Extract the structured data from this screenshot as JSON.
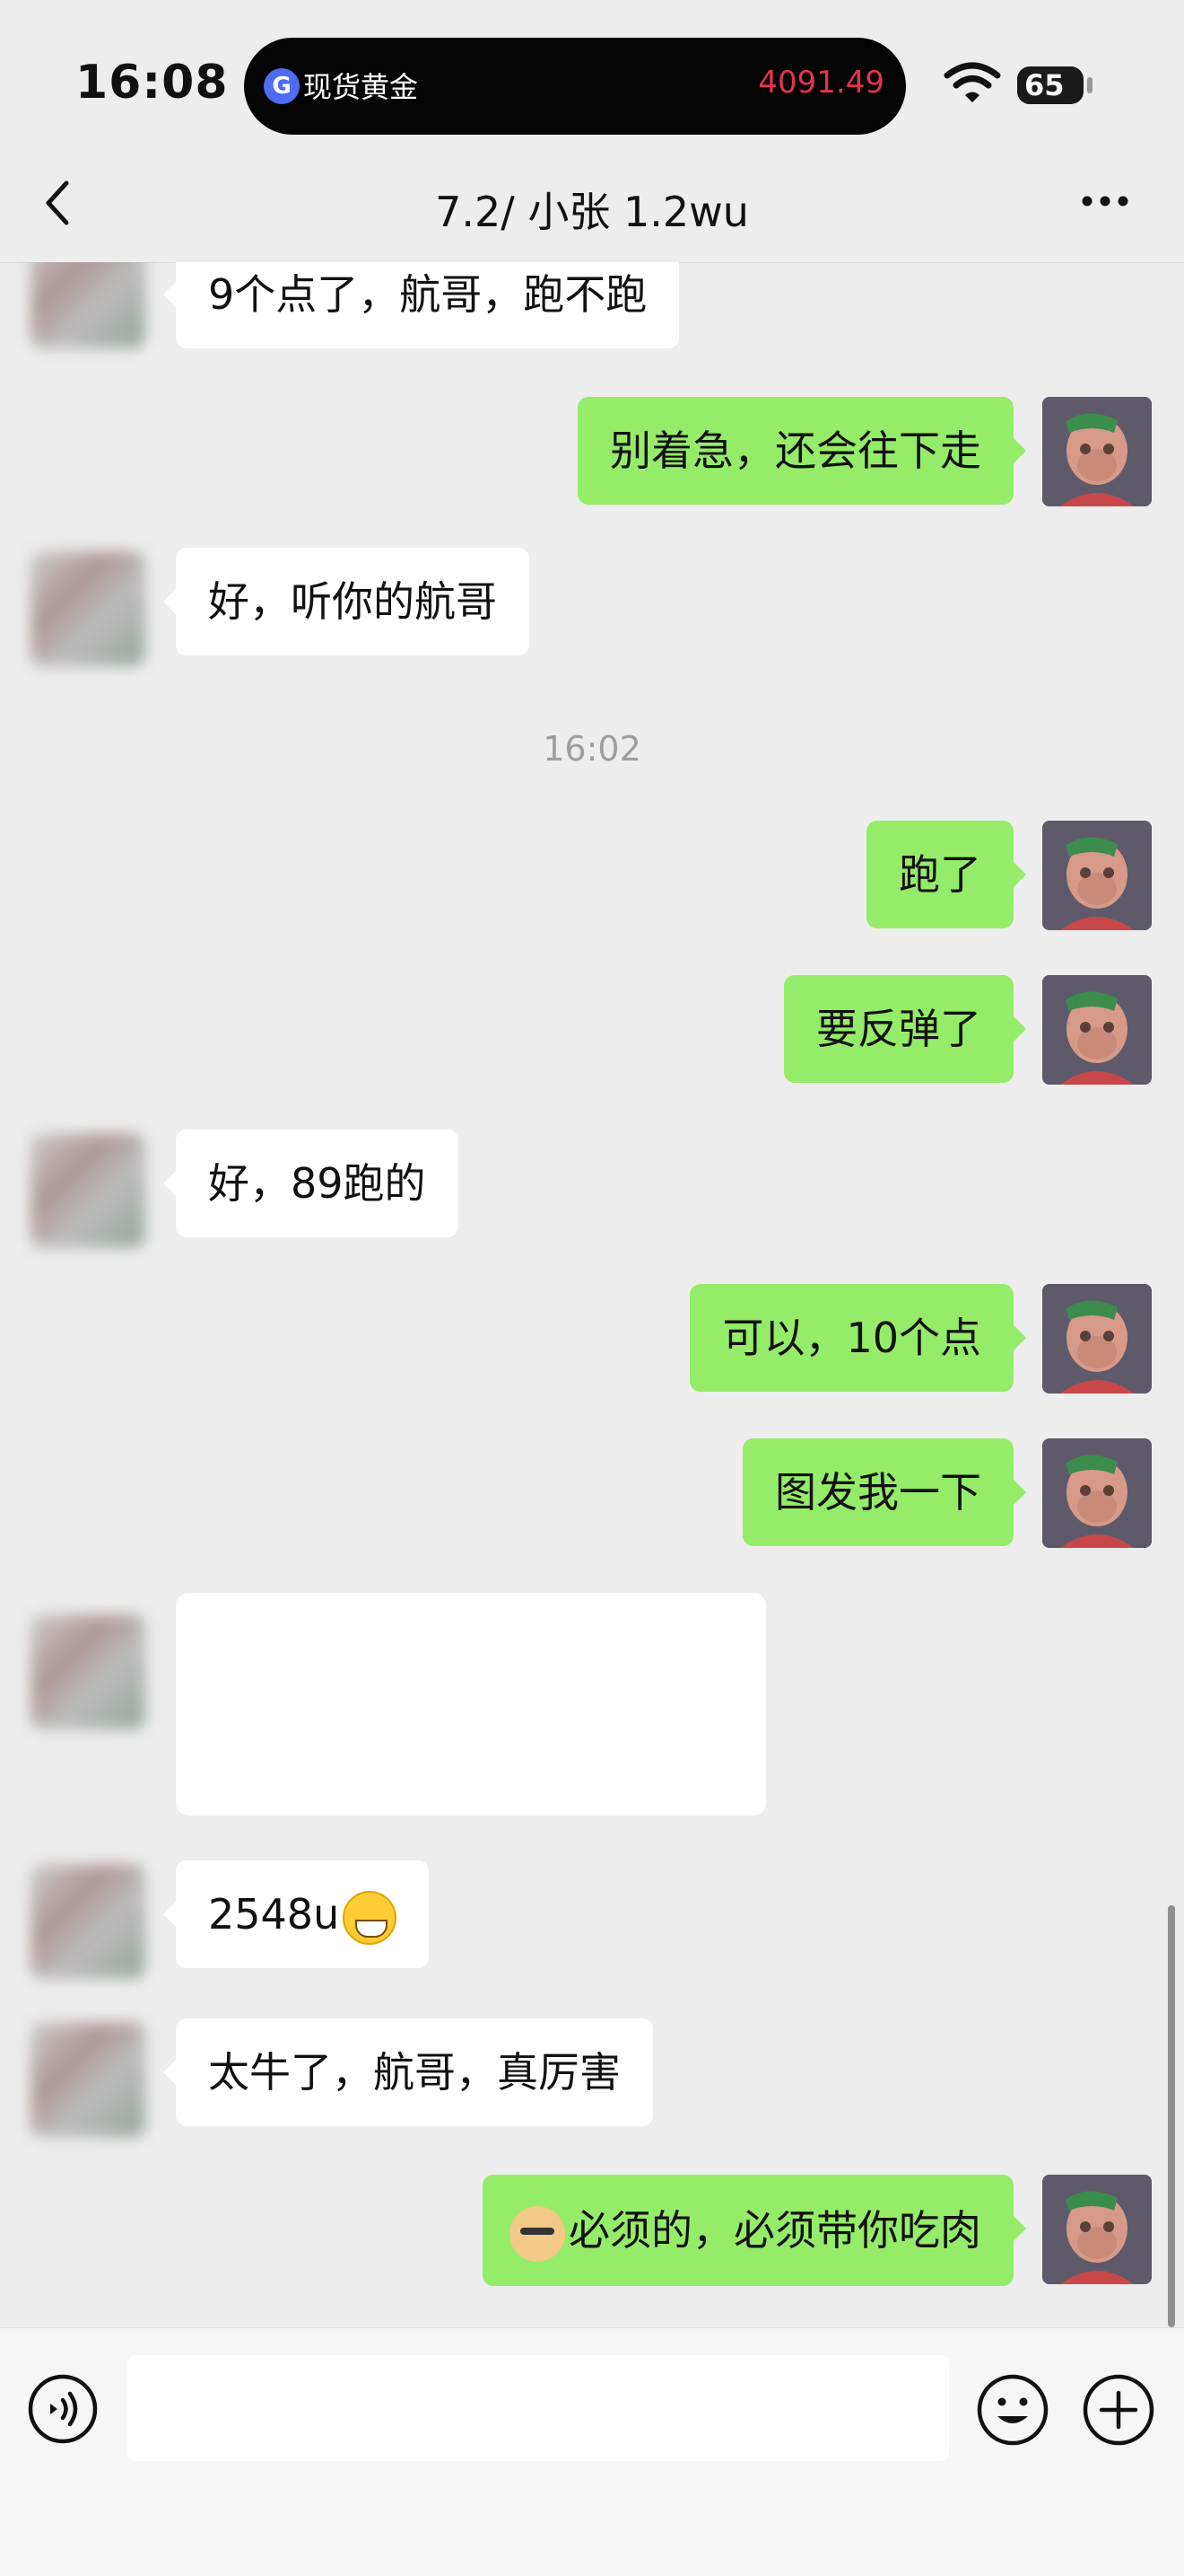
{
  "status_bar": {
    "time": "16:08",
    "island_icon_glyph": "G",
    "island_label": "现货黄金",
    "island_price": "4091.49",
    "battery": "65"
  },
  "nav": {
    "title": "7.2/ 小张 1.2wu"
  },
  "messages": [
    {
      "side": "left",
      "text": "9个点了，航哥，跑不跑"
    },
    {
      "side": "right",
      "text": "别着急，还会往下走"
    },
    {
      "side": "left",
      "text": "好，听你的航哥"
    },
    {
      "type": "timestamp",
      "text": "16:02"
    },
    {
      "side": "right",
      "text": "跑了"
    },
    {
      "side": "right",
      "text": "要反弹了"
    },
    {
      "side": "left",
      "text": "好，89跑的"
    },
    {
      "side": "right",
      "text": "可以，10个点"
    },
    {
      "side": "right",
      "text": "图发我一下"
    },
    {
      "side": "left",
      "type": "image"
    },
    {
      "side": "left",
      "text": "2548u",
      "emoji": "grin-emoji"
    },
    {
      "side": "left",
      "text": "太牛了，航哥，真厉害"
    },
    {
      "side": "right",
      "text": "必须的，必须带你吃肉",
      "emoji": "doge-emoji"
    }
  ],
  "colors": {
    "chat_background": "#EDEDED",
    "bubble_outgoing": "#95EC69",
    "bubble_incoming": "#FFFFFF",
    "island_price": "#E6334F"
  },
  "icons": [
    "back-icon",
    "more-icon",
    "voice-icon",
    "emoji-icon",
    "plus-icon",
    "wifi-icon",
    "battery-icon"
  ]
}
